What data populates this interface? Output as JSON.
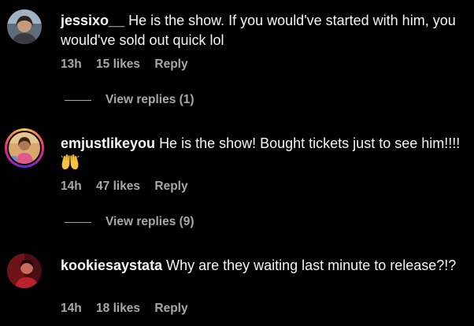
{
  "comments": [
    {
      "username": "jessixo__",
      "text": "He is the show. If you would've started with him, you would've sold out quick lol",
      "time": "13h",
      "likes": "15 likes",
      "reply_label": "Reply",
      "view_replies": "View replies (1)"
    },
    {
      "username": "emjustlikeyou",
      "text": "He is the show! Bought tickets just to see him!!!! ",
      "emoji": "raised-hands",
      "time": "14h",
      "likes": "47 likes",
      "reply_label": "Reply",
      "view_replies": "View replies (9)"
    },
    {
      "username": "kookiesaystata",
      "text": "Why are they waiting last minute to release?!?",
      "time": "14h",
      "likes": "18 likes",
      "reply_label": "Reply"
    }
  ],
  "colors": {
    "background": "#000000",
    "primary_text": "#f5f5f5",
    "secondary_text": "#a8a8a8",
    "story_ring": [
      "#f9ce34",
      "#ee2a7b",
      "#6228d7"
    ]
  }
}
